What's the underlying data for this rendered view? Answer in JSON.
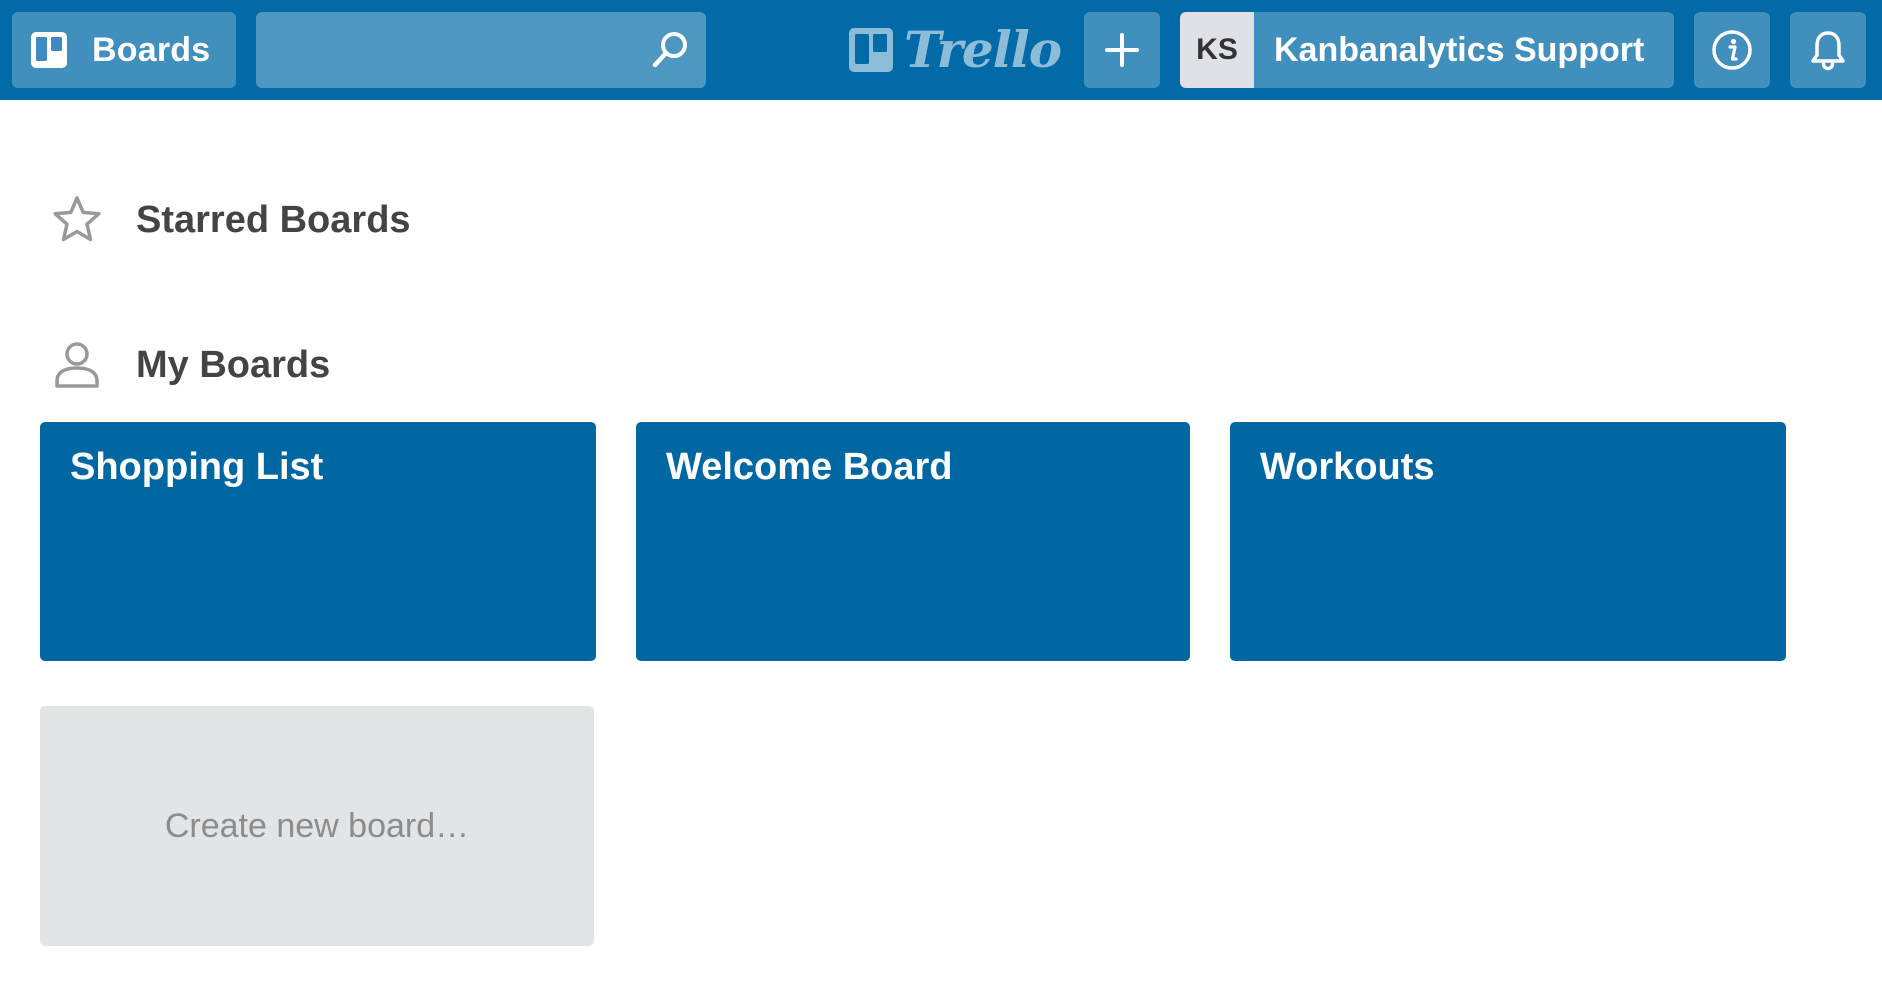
{
  "header": {
    "boards_label": "Boards",
    "search": {
      "value": "",
      "placeholder": ""
    },
    "logo_text": "Trello",
    "account": {
      "initials": "KS",
      "name": "Kanbanalytics Support"
    },
    "icons": {
      "boards": "boards-icon",
      "search": "search-icon",
      "add": "plus-icon",
      "info": "info-icon",
      "notifications": "bell-icon"
    }
  },
  "sections": {
    "starred": {
      "title": "Starred Boards",
      "icon": "star-icon"
    },
    "mine": {
      "title": "My Boards",
      "icon": "person-icon"
    }
  },
  "boards": [
    {
      "title": "Shopping List"
    },
    {
      "title": "Welcome Board"
    },
    {
      "title": "Workouts"
    }
  ],
  "create_board_label": "Create new board…",
  "colors": {
    "header_bg": "#026aa7",
    "board_tile": "#0067a3",
    "create_tile": "#e2e4e6",
    "section_title": "#444444"
  }
}
